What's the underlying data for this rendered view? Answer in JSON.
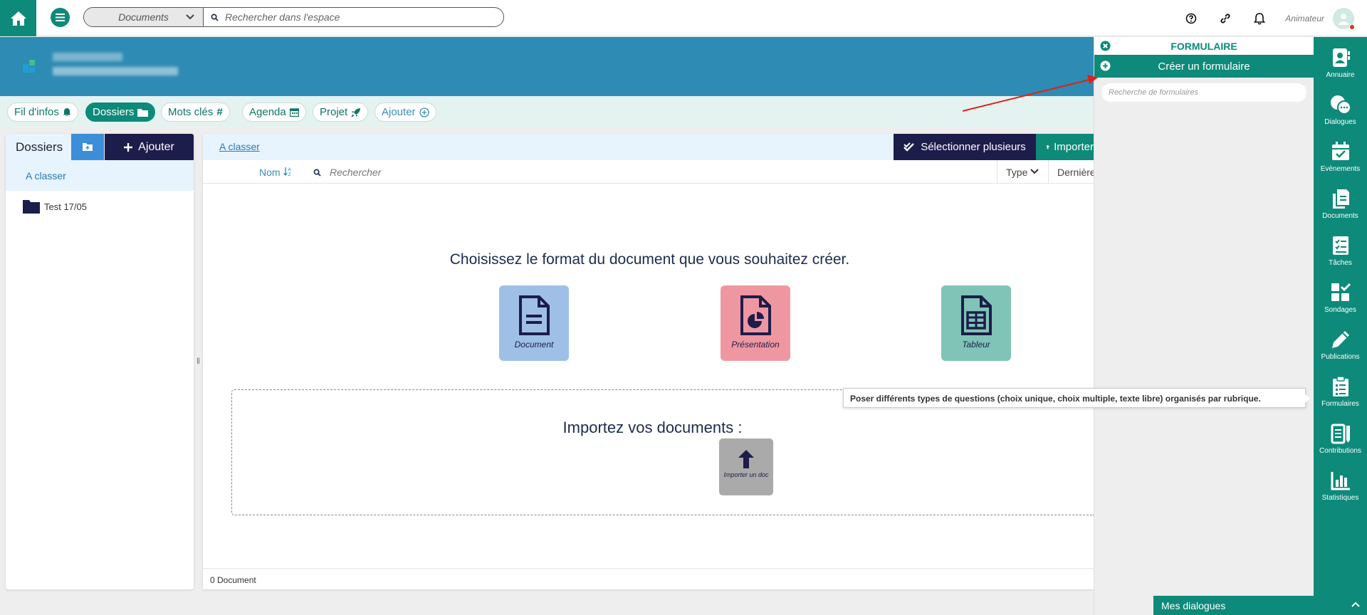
{
  "topbar": {
    "scope": "Documents",
    "search_placeholder": "Rechercher dans l'espace",
    "user_label": "Animateur"
  },
  "nav": {
    "pills": [
      {
        "label": "Fil d'infos"
      },
      {
        "label": "Dossiers"
      },
      {
        "label": "Mots clés"
      },
      {
        "label": "Agenda"
      },
      {
        "label": "Projet"
      },
      {
        "label": "Ajouter"
      }
    ]
  },
  "folders": {
    "title": "Dossiers",
    "add_label": "Ajouter",
    "active_item": "A classer",
    "items": [
      {
        "label": "Test 17/05"
      }
    ]
  },
  "main": {
    "breadcrumb": "A classer",
    "select_multiple": "Sélectionner plusieurs",
    "import_label": "Importer",
    "columns": {
      "name": "Nom",
      "search_placeholder": "Rechercher",
      "type": "Type",
      "last": "Dernière"
    },
    "choose_title": "Choisissez le format du document que vous souhaitez créer.",
    "formats": [
      {
        "label": "Document",
        "color": "#9ec0e6"
      },
      {
        "label": "Présentation",
        "color": "#ef97a0"
      },
      {
        "label": "Tableur",
        "color": "#7fc4b6"
      }
    ],
    "import_title": "Importez vos documents :",
    "import_button": "Importer un doc",
    "footer_count": "0 Document"
  },
  "right_panel": {
    "title": "FORMULAIRE",
    "create_label": "Créer un formulaire",
    "search_placeholder": "Recherche de formulaires"
  },
  "tooltip": "Poser différents types de questions (choix unique, choix multiple, texte libre) organisés par rubrique.",
  "sidebar": {
    "items": [
      {
        "label": "Annuaire",
        "icon": "address-book-icon"
      },
      {
        "label": "Dialogues",
        "icon": "chat-icon"
      },
      {
        "label": "Evènements",
        "icon": "calendar-icon"
      },
      {
        "label": "Documents",
        "icon": "documents-icon"
      },
      {
        "label": "Tâches",
        "icon": "tasks-icon"
      },
      {
        "label": "Sondages",
        "icon": "poll-icon"
      },
      {
        "label": "Publications",
        "icon": "pencil-icon"
      },
      {
        "label": "Formulaires",
        "icon": "clipboard-icon"
      },
      {
        "label": "Contributions",
        "icon": "contributions-icon"
      },
      {
        "label": "Statistiques",
        "icon": "stats-icon"
      }
    ]
  },
  "dialogs_bar": "Mes dialogues",
  "colors": {
    "brand": "#0d8a7a",
    "banner": "#2e8bb3",
    "dark": "#1d1d4b",
    "link": "#2a79b8"
  }
}
